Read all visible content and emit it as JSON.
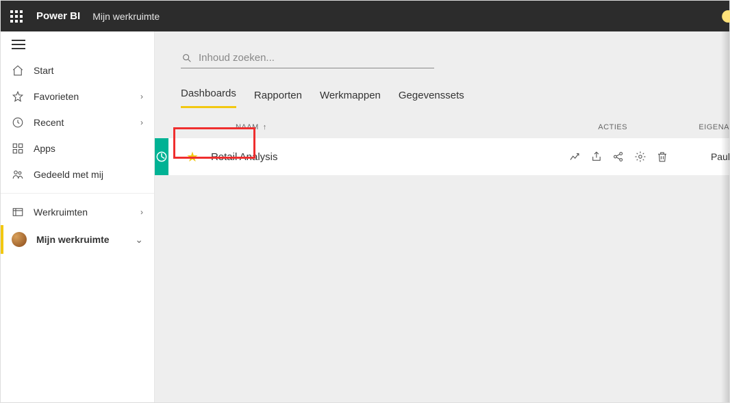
{
  "header": {
    "brand": "Power BI",
    "breadcrumb": "Mijn werkruimte"
  },
  "sidebar": {
    "items": [
      {
        "icon": "home",
        "label": "Start",
        "chevron": false
      },
      {
        "icon": "star-outline",
        "label": "Favorieten",
        "chevron": true
      },
      {
        "icon": "clock",
        "label": "Recent",
        "chevron": true
      },
      {
        "icon": "apps",
        "label": "Apps",
        "chevron": false
      },
      {
        "icon": "shared",
        "label": "Gedeeld met mij",
        "chevron": false
      }
    ],
    "workspaces": {
      "icon": "workspaces",
      "label": "Werkruimten"
    },
    "my_workspace": {
      "label": "Mijn werkruimte"
    }
  },
  "search": {
    "placeholder": "Inhoud zoeken..."
  },
  "tabs": [
    {
      "label": "Dashboards",
      "active": true
    },
    {
      "label": "Rapporten",
      "active": false
    },
    {
      "label": "Werkmappen",
      "active": false
    },
    {
      "label": "Gegevenssets",
      "active": false
    }
  ],
  "columns": {
    "name": "NAAM",
    "actions": "ACTIES",
    "owner": "EIGENA"
  },
  "rows": [
    {
      "name": "Retail Analysis",
      "owner": "Paul Inb",
      "favorite": true
    }
  ],
  "action_icons": [
    "metrics",
    "share-out",
    "share-link",
    "settings",
    "delete"
  ],
  "highlights": [
    "dashboards-tab",
    "delete-action"
  ]
}
